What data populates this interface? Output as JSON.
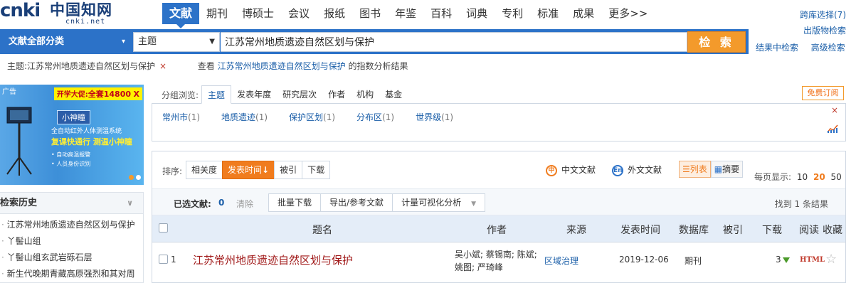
{
  "logo": {
    "brand": "cnki",
    "cn_name": "中国知网",
    "url": "cnki.net"
  },
  "nav": {
    "tabs": [
      "文献",
      "期刊",
      "博硕士",
      "会议",
      "报纸",
      "图书",
      "年鉴",
      "百科",
      "词典",
      "专利",
      "标准",
      "成果",
      "更多>>"
    ],
    "active": "文献",
    "cross_select": "跨库选择(7)",
    "publication_search": "出版物检索"
  },
  "search": {
    "classify_label": "文献全部分类",
    "field": "主题",
    "query": "江苏常州地质遗迹自然区划与保护",
    "button": "检 索",
    "in_results": "结果中检索",
    "advanced": "高级检索"
  },
  "crumb": {
    "topic": "主题:江苏常州地质遗迹自然区划与保护",
    "close": "×",
    "view_prefix": "查看",
    "view_link": "江苏常州地质遗迹自然区划与保护",
    "view_suffix": "的指数分析结果"
  },
  "ad": {
    "caption": "广告",
    "promo_prefix": "开学大促:",
    "promo_value": "全套14800",
    "promo_close": "X",
    "name": "小神瞳",
    "line1": "全自动红外人体测温系统",
    "line2": "复课快通行 测温小神瞳",
    "bullet1": "• 自动高温报警",
    "bullet2": "• 人员身份识别"
  },
  "history": {
    "title": "检索历史",
    "items": [
      "江苏常州地质遗迹自然区划与保护",
      "丫髻山组",
      "丫髻山组玄武岩砾石层",
      "新生代晚期青藏高原强烈和其对周"
    ]
  },
  "group": {
    "label": "分组浏览:",
    "tabs": [
      "主题",
      "发表年度",
      "研究层次",
      "作者",
      "机构",
      "基金"
    ],
    "active_tab": "主题",
    "facets": [
      {
        "name": "常州市",
        "count": "(1)"
      },
      {
        "name": "地质遗迹",
        "count": "(1)"
      },
      {
        "name": "保护区划",
        "count": "(1)"
      },
      {
        "name": "分布区",
        "count": "(1)"
      },
      {
        "name": "世界级",
        "count": "(1)"
      }
    ],
    "free_subscribe": "免费订阅",
    "close": "×"
  },
  "results": {
    "sort_label": "排序:",
    "sort_options": [
      "相关度",
      "发表时间",
      "被引",
      "下载"
    ],
    "sort_active": "发表时间",
    "sort_arrow": "↓",
    "lang_cn": "中文文献",
    "lang_en": "外文文献",
    "lang_cn_icon": "中",
    "lang_en_icon": "En",
    "view_list": "列表",
    "view_abstract": "摘要",
    "per_page_label": "每页显示:",
    "per_page": [
      "10",
      "20",
      "50"
    ],
    "per_page_active": "20",
    "selected_label": "已选文献:",
    "selected_count": "0",
    "clear": "清除",
    "batch_download": "批量下载",
    "export": "导出/参考文献",
    "visual_analysis": "计量可视化分析",
    "found": "找到 1 条结果",
    "columns": {
      "title": "题名",
      "author": "作者",
      "source": "来源",
      "date": "发表时间",
      "db": "数据库",
      "cited": "被引",
      "downloads": "下载",
      "read": "阅读",
      "favorite": "收藏"
    },
    "rows": [
      {
        "index": "1",
        "title": "江苏常州地质遗迹自然区划与保护",
        "author_line1": "吴小斌; 蔡锡南; 陈斌;",
        "author_line2": "姚图; 严琦峰",
        "source": "区域治理",
        "date": "2019-12-06",
        "db": "期刊",
        "cited": "",
        "downloads": "3",
        "read": "HTML",
        "favorite": "☆"
      }
    ]
  },
  "colors": {
    "primary": "#2c72c8",
    "accent": "#f39a2b",
    "title_red": "#a01818",
    "link": "#1a5ea8"
  }
}
